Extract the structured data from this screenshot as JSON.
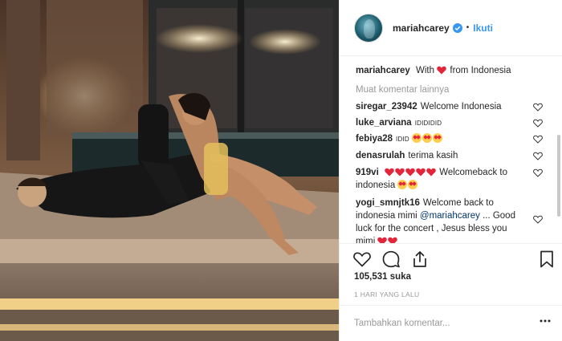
{
  "post": {
    "username": "mariahcarey",
    "separator": "•",
    "follow_label": "Ikuti",
    "caption_prefix": "With",
    "caption_suffix": "from Indonesia",
    "more_comments": "Muat komentar lainnya",
    "comments": [
      {
        "user": "siregar_23942",
        "text": "Welcome Indonesia"
      },
      {
        "user": "luke_arviana",
        "text": "IDIDIDID"
      },
      {
        "user": "febiya28",
        "text": "IDID"
      },
      {
        "user": "denasrulah",
        "text": "terima kasih"
      },
      {
        "user": "919vi",
        "text_after_hearts": "Welcomeback to",
        "text_line2": "indonesia"
      },
      {
        "user": "yogi_smnjtk16",
        "text_a": "Welcome back to",
        "text_b": "indonesia mimi",
        "mention": "@mariahcarey",
        "text_c": "... Good",
        "text_d": "luck for the concert , Jesus bless you",
        "text_e": "mimi"
      }
    ],
    "likes_count": "105,531",
    "likes_word": "suka",
    "time_ago": "1 HARI YANG LALU",
    "add_comment_placeholder": "Tambahkan komentar..."
  },
  "colors": {
    "link": "#3897f0",
    "heart": "#ed4956",
    "muted": "#999999"
  },
  "icons": [
    "heart-icon",
    "comment-icon",
    "share-icon",
    "bookmark-icon",
    "verified-icon",
    "more-dots-icon"
  ]
}
